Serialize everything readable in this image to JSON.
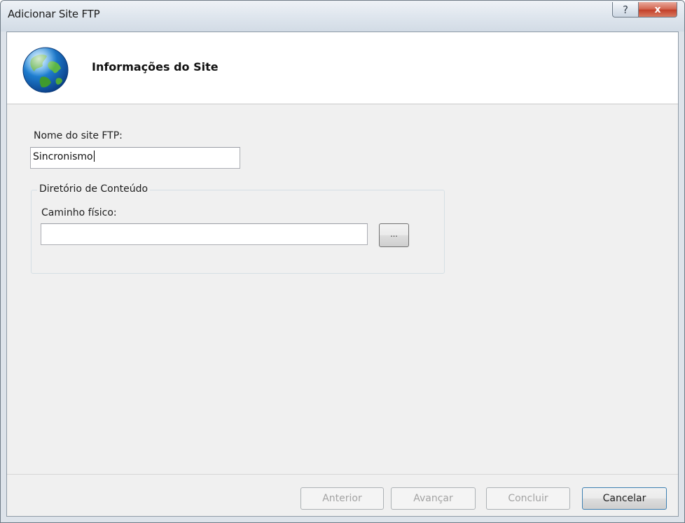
{
  "window": {
    "title": "Adicionar Site FTP",
    "help_glyph": "?",
    "close_glyph": "x"
  },
  "header": {
    "heading": "Informações do Site",
    "icon": "globe-icon"
  },
  "form": {
    "site_name_label": "Nome do site FTP:",
    "site_name_value": "Sincronismo",
    "content_group_label": "Diretório de Conteúdo",
    "physical_path_label": "Caminho físico:",
    "physical_path_value": "",
    "browse_label": "..."
  },
  "buttons": {
    "previous": "Anterior",
    "next": "Avançar",
    "finish": "Concluir",
    "cancel": "Cancelar"
  },
  "colors": {
    "close_button": "#c3412b",
    "dialog_background": "#f0f0f0",
    "header_background": "#ffffff"
  }
}
